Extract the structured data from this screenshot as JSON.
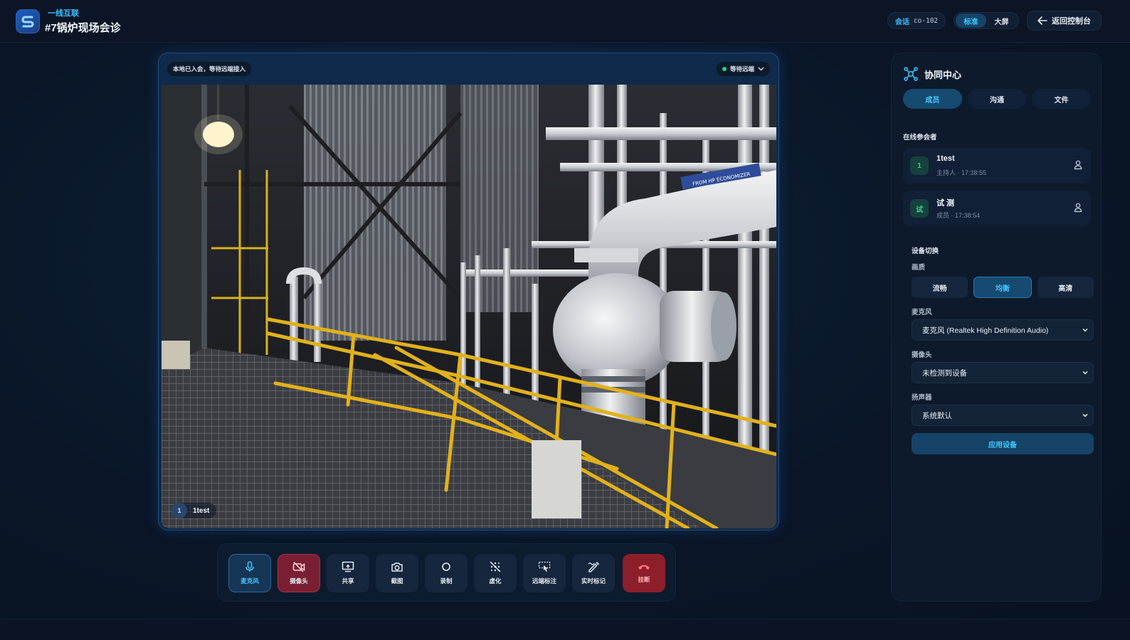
{
  "header": {
    "brand": "一线互联",
    "title": "#7锅炉现场会诊",
    "session_key": "会话",
    "session_value": "co-102",
    "modes": [
      {
        "label": "标准",
        "active": true
      },
      {
        "label": "大屏",
        "active": false
      }
    ],
    "back_label": "返回控制台"
  },
  "video": {
    "status_text": "本地已入会，等待远端接入",
    "wait_label": "等待远端",
    "tile": {
      "number": "1",
      "name": "1test"
    },
    "feed_icon": "industrial-boiler-scene",
    "pipe_sign": "FROM HP ECONOMIZER"
  },
  "toolbar": {
    "items": [
      {
        "label": "麦克风",
        "icon": "mic-icon",
        "state": "active"
      },
      {
        "label": "摄像头",
        "icon": "camera-off-icon",
        "state": "danger"
      },
      {
        "label": "共享",
        "icon": "screen-share-icon",
        "state": "normal"
      },
      {
        "label": "截图",
        "icon": "screenshot-icon",
        "state": "normal"
      },
      {
        "label": "录制",
        "icon": "record-icon",
        "state": "normal"
      },
      {
        "label": "虚化",
        "icon": "blur-icon",
        "state": "normal"
      },
      {
        "label": "远端标注",
        "icon": "remote-annotate-icon",
        "state": "normal"
      },
      {
        "label": "实时标记",
        "icon": "live-mark-icon",
        "state": "normal"
      },
      {
        "label": "挂断",
        "icon": "hangup-icon",
        "state": "hangup"
      }
    ]
  },
  "sidebar": {
    "title": "协同中心",
    "tabs": [
      {
        "label": "成员",
        "active": true
      },
      {
        "label": "沟通",
        "active": false
      },
      {
        "label": "文件",
        "active": false
      }
    ],
    "online_heading": "在线参会者",
    "participants": [
      {
        "avatar": "1",
        "name": "1test",
        "meta": "主持人 · 17:38:55"
      },
      {
        "avatar": "试",
        "name": "试 测",
        "meta": "成员 · 17:38:54"
      }
    ],
    "devices": {
      "heading": "设备切换",
      "quality_label": "画质",
      "quality_options": [
        {
          "label": "流畅",
          "active": false
        },
        {
          "label": "均衡",
          "active": true
        },
        {
          "label": "高清",
          "active": false
        }
      ],
      "mic_label": "麦克风",
      "mic_value": "麦克风 (Realtek High Definition Audio)",
      "camera_label": "摄像头",
      "camera_value": "未检测到设备",
      "speaker_label": "扬声器",
      "speaker_value": "系统默认",
      "apply_label": "应用设备"
    }
  },
  "colors": {
    "accent": "#43c9ff",
    "online_green": "#2ad17a",
    "danger": "#7a1f32"
  }
}
